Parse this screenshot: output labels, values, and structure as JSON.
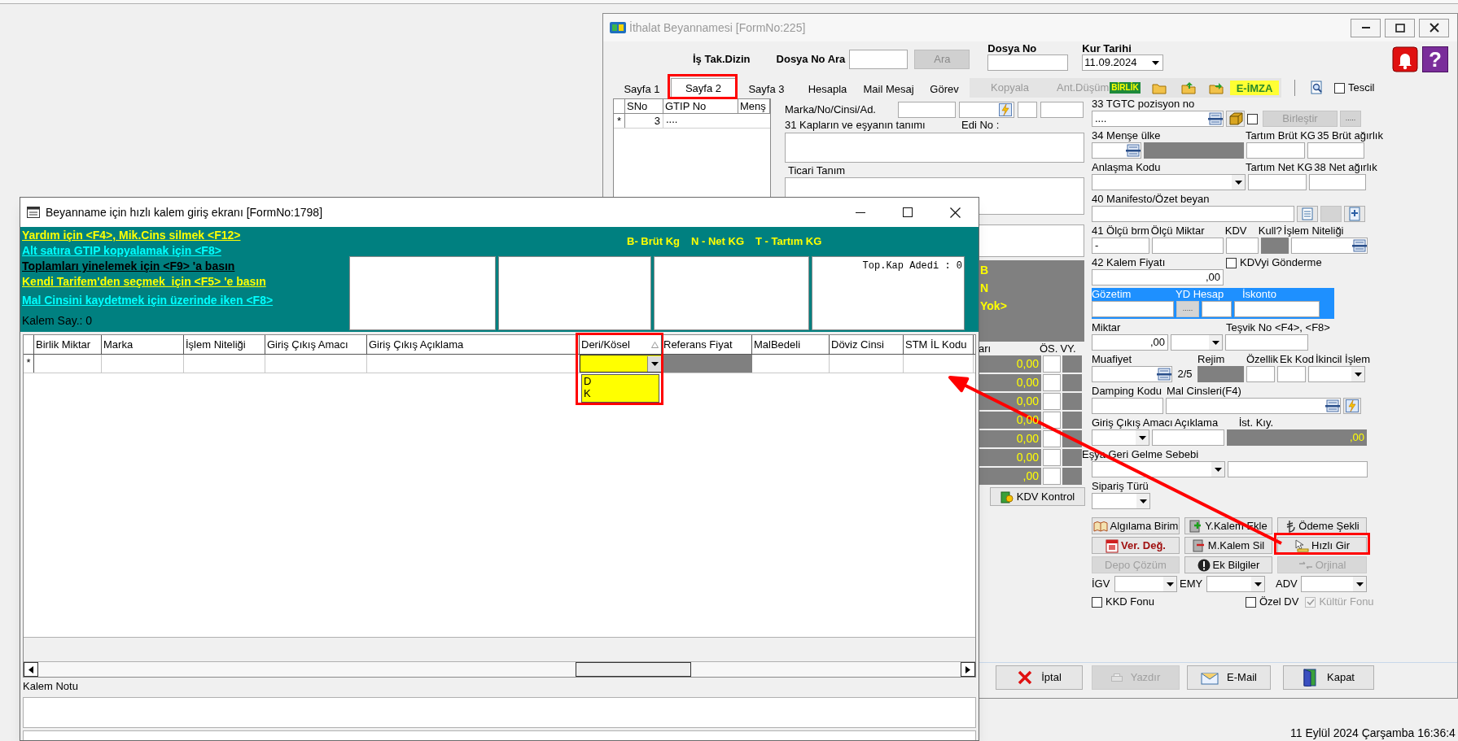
{
  "desktop": {
    "status_text": "11 Eylül 2024 Çarşamba 16:36:4"
  },
  "back_window": {
    "title": "İthalat Beyannamesi [FormNo:225]",
    "header": {
      "dizin_label": "İş Tak.Dizin",
      "search_label": "Dosya No Ara",
      "search_button": "Ara",
      "dosya_no_label": "Dosya No",
      "kur_tarihi_label": "Kur Tarihi",
      "kur_tarihi_value": "11.09.2024",
      "help_glyph": "?"
    },
    "tabs": [
      {
        "label": "Sayfa 1",
        "selected": false
      },
      {
        "label": "Sayfa 2",
        "selected": true
      },
      {
        "label": "Sayfa 3",
        "selected": false
      },
      {
        "label": "Hesapla",
        "selected": false
      },
      {
        "label": "Mail Mesaj",
        "selected": false
      },
      {
        "label": "Görev",
        "selected": false
      }
    ],
    "toolbar": {
      "kopyala": "Kopyala",
      "ant_dusum": "Ant.Düşüm",
      "birlik_badge": "BİRLİK",
      "e_imza": "E-İMZA",
      "tescil": {
        "label": "Tescil",
        "checked": false
      }
    },
    "item_grid": {
      "columns": [
        "SNo",
        "GTIP No",
        "Menş"
      ],
      "rows": [
        {
          "marker": "*",
          "sno": "3",
          "gtip": "...."
        }
      ]
    },
    "marka_label": "Marka/No/Cinsi/Ad.",
    "kaplar_label": "31 Kapların ve eşyanın tanımı",
    "edi_no_label": "Edi No :",
    "ticari_tanim_label": "Ticari Tanım",
    "side_labels": [
      "B",
      "N",
      "Yok>"
    ],
    "totals": {
      "header": "arı",
      "os_label": "ÖS.",
      "vy_label": "VY.",
      "values": [
        "0,00",
        "0,00",
        "0,00",
        "0,00",
        "0,00",
        "0,00",
        ",00"
      ]
    },
    "kdv_kontrol": "KDV Kontrol",
    "form": [
      {
        "kind": "plain",
        "labels": [
          "33 TGTC pozisyon no"
        ],
        "fields": [
          {
            "kind": "lookup",
            "value": "...."
          },
          {
            "kind": "icon_button"
          },
          {
            "kind": "checkbox",
            "checked": false
          },
          {
            "kind": "button",
            "label": "Birleştir",
            "disabled": true
          },
          {
            "kind": "button",
            "label": ".....",
            "disabled": true
          }
        ]
      },
      {
        "kind": "plain",
        "labels": [
          "34 Menşe ülke",
          "Tartım Brüt KG",
          "35 Brüt ağırlık"
        ],
        "fields": [
          {
            "kind": "lookup"
          },
          {
            "kind": "readonly"
          },
          {
            "kind": "text"
          },
          {
            "kind": "text"
          }
        ]
      },
      {
        "kind": "plain",
        "labels": [
          "Anlaşma Kodu",
          "Tartım Net KG",
          "38 Net ağırlık"
        ],
        "fields": [
          {
            "kind": "combo"
          },
          {
            "kind": "text"
          },
          {
            "kind": "text"
          }
        ]
      },
      {
        "kind": "plain",
        "labels": [
          "40 Manifesto/Özet beyan"
        ],
        "fields": [
          {
            "kind": "text"
          },
          {
            "kind": "icon_button"
          },
          {
            "kind": "button",
            "disabled": true
          },
          {
            "kind": "icon_button"
          }
        ]
      },
      {
        "kind": "plain",
        "labels": [
          "41 Ölçü brm",
          "Ölçü Miktar",
          "KDV",
          "Kull?",
          "İşlem Niteliği"
        ],
        "fields": [
          {
            "kind": "text",
            "value": "-"
          },
          {
            "kind": "text"
          },
          {
            "kind": "text"
          },
          {
            "kind": "readonly"
          },
          {
            "kind": "lookup"
          }
        ]
      },
      {
        "kind": "plain",
        "labels": [
          "42 Kalem Fiyatı"
        ],
        "check": {
          "label": "KDVyi Gönderme",
          "checked": false
        },
        "fields": [
          {
            "kind": "number",
            "value": ",00"
          }
        ]
      },
      {
        "kind": "panel",
        "labels": [
          "Gözetim",
          "YD Hesap",
          "İskonto"
        ],
        "fields": [
          {
            "kind": "text"
          },
          {
            "kind": "button",
            "label": ".....",
            "disabled": true
          },
          {
            "kind": "text"
          },
          {
            "kind": "text"
          }
        ]
      },
      {
        "kind": "plain",
        "labels": [
          "Miktar",
          "Teşvik No <F4>, <F8>"
        ],
        "fields": [
          {
            "kind": "number",
            "value": ",00"
          },
          {
            "kind": "combo"
          },
          {
            "kind": "text"
          }
        ]
      },
      {
        "kind": "plain",
        "labels": [
          "Muafiyet",
          "Rejim",
          "Özellik",
          "Ek Kod",
          "İkincil İşlem"
        ],
        "fields": [
          {
            "kind": "lookup"
          },
          {
            "kind": "caption",
            "value": "2/5"
          },
          {
            "kind": "readonly"
          },
          {
            "kind": "text"
          },
          {
            "kind": "text"
          },
          {
            "kind": "combo"
          }
        ]
      },
      {
        "kind": "plain",
        "labels": [
          "Damping Kodu",
          "Mal Cinsleri(F4)"
        ],
        "fields": [
          {
            "kind": "text"
          },
          {
            "kind": "lookup"
          },
          {
            "kind": "icon_button"
          }
        ]
      },
      {
        "kind": "plain",
        "labels": [
          "Giriş Çıkış Amacı",
          "Açıklama",
          "İst. Kıy."
        ],
        "fields": [
          {
            "kind": "combo"
          },
          {
            "kind": "text"
          },
          {
            "kind": "readonly",
            "value": ",00"
          }
        ]
      },
      {
        "kind": "outdent",
        "labels": [
          "Eşya Geri Gelme Sebebi"
        ],
        "fields": [
          {
            "kind": "combo"
          },
          {
            "kind": "text"
          }
        ]
      },
      {
        "kind": "plain",
        "labels": [
          "Sipariş Türü"
        ],
        "fields": [
          {
            "kind": "combo"
          }
        ]
      }
    ],
    "action_buttons": [
      {
        "label": "Algılama Birim",
        "disabled": false,
        "highlighted": false
      },
      {
        "label": "Y.Kalem Ekle",
        "disabled": false,
        "highlighted": false
      },
      {
        "label": "Ödeme Şekli",
        "disabled": false,
        "highlighted": false
      },
      {
        "label": "Ver. Değ.",
        "disabled": false,
        "highlighted": true
      },
      {
        "label": "M.Kalem Sil",
        "disabled": false,
        "highlighted": false
      },
      {
        "label": "Hızlı Gir",
        "disabled": false,
        "highlighted": false
      },
      {
        "label": "Depo Çözüm",
        "disabled": true,
        "highlighted": false
      },
      {
        "label": "Ek Bilgiler",
        "disabled": false,
        "highlighted": false
      },
      {
        "label": "Orjinal",
        "disabled": true,
        "highlighted": false
      }
    ],
    "rate_fields": [
      "İGV",
      "EMY",
      "ADV"
    ],
    "options": [
      {
        "label": "KKD Fonu",
        "checked": false,
        "disabled": false
      },
      {
        "label": "Özel DV",
        "checked": false,
        "disabled": false
      },
      {
        "label": "Kültür Fonu",
        "checked": true,
        "disabled": true
      }
    ],
    "bottom_buttons": [
      {
        "label": "İptal",
        "disabled": false
      },
      {
        "label": "Yazdır",
        "disabled": true
      },
      {
        "label": "E-Mail",
        "disabled": false
      },
      {
        "label": "Kapat",
        "disabled": false
      }
    ]
  },
  "front_window": {
    "title": "Beyanname için hızlı kalem giriş ekranı [FormNo:1798]",
    "hints": [
      {
        "text": "Yardım için <F4>, Mik.Cins silmek <F12>",
        "color": "#ffff00"
      },
      {
        "text": "Alt satıra GTIP kopyalamak için <F8>",
        "color": "#00ffff"
      },
      {
        "text": "Toplamları yinelemek için <F9> 'a basın",
        "color": "#000000"
      },
      {
        "text": "Kendi Tarifem'den seçmek  için <F5> 'e basın",
        "color": "#ffff00"
      },
      {
        "text": "Mal Cinsini kaydetmek için üzerinde iken <F8>",
        "color": "#00ffff"
      }
    ],
    "kalem_say": "Kalem Say.: 0",
    "legend": [
      "B- Brüt Kg",
      "N - Net KG",
      "T - Tartım KG"
    ],
    "top_kap_adedi": "Top.Kap Adedi : 0",
    "grid": {
      "columns": [
        {
          "label": "Birlik Miktar",
          "sorted": false,
          "kind": "text"
        },
        {
          "label": "Marka",
          "sorted": false,
          "kind": "text"
        },
        {
          "label": "İşlem Niteliği",
          "sorted": false,
          "kind": "text"
        },
        {
          "label": "Giriş Çıkış Amacı",
          "sorted": false,
          "kind": "text"
        },
        {
          "label": "Giriş Çıkış Açıklama",
          "sorted": false,
          "kind": "text"
        },
        {
          "label": "Deri/Kösel",
          "sorted": true,
          "kind": "combo"
        },
        {
          "label": "Referans Fiyat",
          "sorted": false,
          "kind": "readonly"
        },
        {
          "label": "MalBedeli",
          "sorted": false,
          "kind": "text"
        },
        {
          "label": "Döviz Cinsi",
          "sorted": false,
          "kind": "text"
        },
        {
          "label": "STM İL Kodu",
          "sorted": false,
          "kind": "text"
        }
      ],
      "new_row_marker": "*",
      "dropdown_options": [
        "D",
        "K"
      ]
    },
    "kalem_notu_label": "Kalem Notu"
  }
}
